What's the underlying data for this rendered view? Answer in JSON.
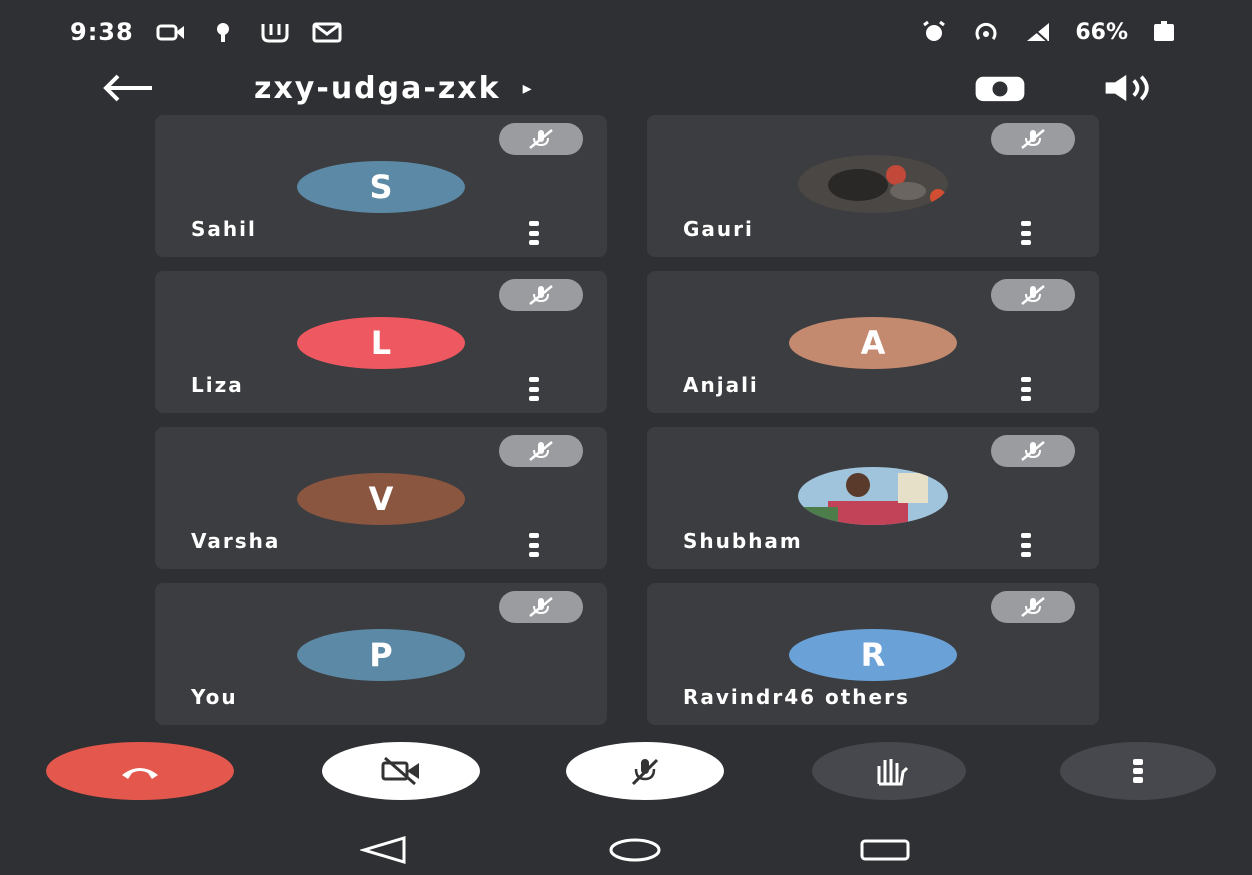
{
  "status_bar": {
    "time": "9:38",
    "battery": "66%",
    "icons_left": [
      "video-icon",
      "podcast-icon",
      "app-icon",
      "gmail-icon"
    ],
    "icons_right": [
      "alarm-icon",
      "hotspot-icon",
      "signal-icon",
      "battery-icon"
    ]
  },
  "top_bar": {
    "meeting_code": "zxy-udga-zxk",
    "caret": "▸",
    "icons": [
      "back-arrow-icon",
      "switch-camera-icon",
      "speaker-icon"
    ]
  },
  "participants": [
    {
      "name": "Sahil",
      "initial": "S",
      "avatar_color": "#5b89a6",
      "muted": true
    },
    {
      "name": "Gauri",
      "initial": "",
      "avatar_photo": true,
      "muted": true
    },
    {
      "name": "Liza",
      "initial": "L",
      "avatar_color": "#ee5860",
      "muted": true
    },
    {
      "name": "Anjali",
      "initial": "A",
      "avatar_color": "#c48a70",
      "muted": true
    },
    {
      "name": "Varsha",
      "initial": "V",
      "avatar_color": "#8a5640",
      "muted": true
    },
    {
      "name": "Shubham",
      "initial": "",
      "avatar_photo": true,
      "muted": true
    },
    {
      "name": "You",
      "initial": "P",
      "avatar_color": "#5b89a6",
      "muted": true
    },
    {
      "name": "Ravindr46 others",
      "initial": "R",
      "avatar_color": "#6aa2d8",
      "muted": true
    }
  ],
  "controls": [
    {
      "name": "end-call-button",
      "icon": "hang-up-icon",
      "color": "#e4574d"
    },
    {
      "name": "camera-toggle-button",
      "icon": "camera-off-icon",
      "color": "#ffffff"
    },
    {
      "name": "mic-toggle-button",
      "icon": "mic-off-icon",
      "color": "#ffffff"
    },
    {
      "name": "raise-hand-button",
      "icon": "hand-icon",
      "color": "#46484d"
    },
    {
      "name": "more-options-button",
      "icon": "more-vert-icon",
      "color": "#46484d"
    }
  ],
  "nav_bar": {
    "icons": [
      "back-triangle-icon",
      "home-circle-icon",
      "recents-square-icon"
    ]
  },
  "colors": {
    "background": "#2f3033",
    "tile": "#3c3d40",
    "mute_badge": "#9a9ca0",
    "end_call": "#e4574d"
  }
}
